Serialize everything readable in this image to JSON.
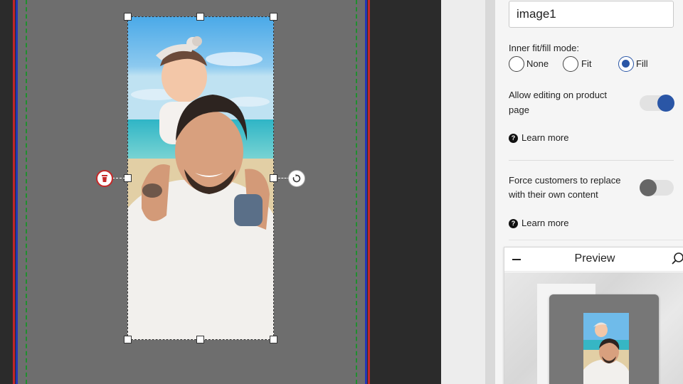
{
  "canvas": {
    "artboard_color": "#6e6e6e",
    "bleed_colors": [
      "#c0262b",
      "#2336b6"
    ],
    "safe_line_color": "#1f8f2e",
    "image_element": {
      "type": "photo",
      "subject": "father-with-baby-on-shoulders-beach",
      "delete_icon": "trash-icon",
      "rotate_icon": "rotate-icon"
    }
  },
  "panel": {
    "name_input_value": "image1",
    "fit_mode": {
      "label": "Inner fit/fill mode:",
      "options": [
        {
          "label": "None",
          "checked": false
        },
        {
          "label": "Fit",
          "checked": false
        },
        {
          "label": "Fill",
          "checked": true
        }
      ]
    },
    "allow_editing": {
      "label_line1": "Allow editing on product",
      "label_line2": "page",
      "enabled": true,
      "learn_more": "Learn more"
    },
    "force_replace": {
      "label_line1": "Force customers to replace",
      "label_line2": "with their own content",
      "enabled": false,
      "learn_more": "Learn more"
    },
    "accent_color": "#2a56a6"
  },
  "preview": {
    "title": "Preview",
    "collapse_icon": "minus-icon",
    "zoom_icon": "search-icon"
  }
}
